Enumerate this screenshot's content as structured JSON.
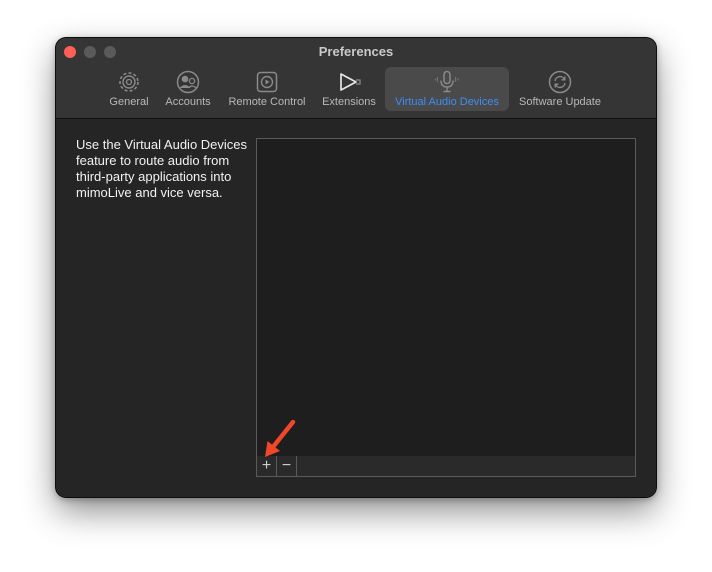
{
  "window": {
    "title": "Preferences"
  },
  "toolbar": {
    "items": [
      {
        "label": "General",
        "icon": "gear-icon"
      },
      {
        "label": "Accounts",
        "icon": "accounts-icon"
      },
      {
        "label": "Remote Control",
        "icon": "remote-control-icon"
      },
      {
        "label": "Extensions",
        "icon": "extensions-icon"
      },
      {
        "label": "Virtual Audio Devices",
        "icon": "microphone-icon",
        "active": true
      },
      {
        "label": "Software Update",
        "icon": "software-update-icon"
      }
    ]
  },
  "main": {
    "description": "Use the Virtual Audio Devices feature to route audio from third-party applications into mimoLive and vice versa.",
    "list": {
      "add_label": "+",
      "remove_label": "−"
    }
  },
  "colors": {
    "accent": "#3d8ef5",
    "annotation_arrow": "#f0462a",
    "close": "#ff5f57"
  }
}
